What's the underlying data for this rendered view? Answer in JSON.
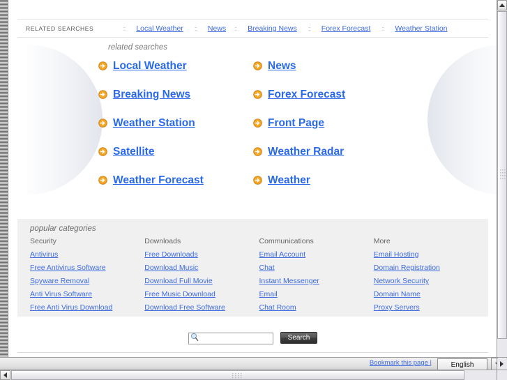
{
  "top_strip": {
    "label": "RELATED SEARCHES",
    "separator": "::",
    "links": [
      "Local Weather",
      "News",
      "Breaking News",
      "Forex Forecast",
      "Weather Station"
    ]
  },
  "related_searches": {
    "heading": "related searches",
    "arrow_icon": "circle-arrow-right-icon",
    "accent_color": "#f0a02a",
    "link_color": "#2a6ae8",
    "links": [
      "Local Weather",
      "News",
      "Breaking News",
      "Forex Forecast",
      "Weather Station",
      "Front Page",
      "Satellite",
      "Weather Radar",
      "Weather Forecast",
      "Weather"
    ]
  },
  "popular_categories": {
    "heading": "popular categories",
    "columns": [
      {
        "title": "Security",
        "links": [
          "Antivirus",
          "Free Antivirus Software",
          "Spyware Removal",
          "Anti Virus Software",
          "Free Anti Virus Download"
        ]
      },
      {
        "title": "Downloads",
        "links": [
          "Free Downloads",
          "Download Music",
          "Download Full Movie",
          "Free Music Download",
          "Download Free Software"
        ]
      },
      {
        "title": "Communications",
        "links": [
          "Email Account",
          "Chat",
          "Instant Messenger",
          "Email",
          "Chat Room"
        ]
      },
      {
        "title": "More",
        "links": [
          "Email Hosting",
          "Domain Registration",
          "Network Security",
          "Domain Name",
          "Proxy Servers"
        ]
      }
    ]
  },
  "search": {
    "value": "",
    "placeholder": "",
    "button_label": "Search",
    "icon": "magnifier-icon"
  },
  "status_bar": {
    "bookmark_label": "Bookmark this page |",
    "language_value": "English",
    "dropdown_icon": "chevron-down-icon"
  },
  "scrollbars": {
    "up_icon": "scroll-up-icon",
    "down_icon": "scroll-down-icon",
    "left_icon": "scroll-left-icon",
    "right_icon": "scroll-right-icon",
    "grip_icon": "grip-dots-icon",
    "resize_icon": "resize-grip-icon"
  }
}
